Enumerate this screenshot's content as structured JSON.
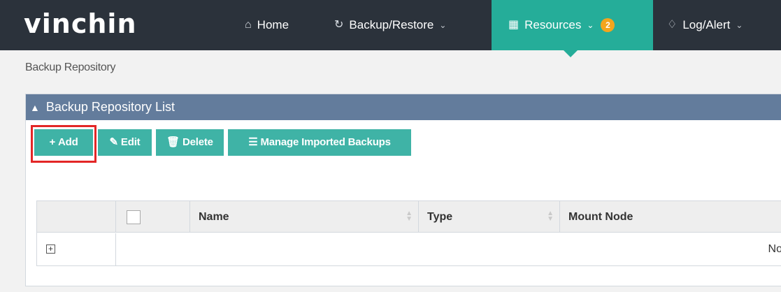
{
  "app": {
    "brand": "vinchin"
  },
  "nav": {
    "home": {
      "label": "Home",
      "icon": "home-icon"
    },
    "backup_restore": {
      "label": "Backup/Restore",
      "icon": "refresh-icon"
    },
    "resources": {
      "label": "Resources",
      "icon": "grid-icon",
      "badge": "2"
    },
    "log_alert": {
      "label": "Log/Alert",
      "icon": "bell-icon"
    }
  },
  "breadcrumb": "Backup Repository",
  "panel": {
    "title": "Backup Repository List"
  },
  "toolbar": {
    "add": "Add",
    "edit": "Edit",
    "delete": "Delete",
    "manage": "Manage Imported Backups"
  },
  "table": {
    "columns": [
      "Name",
      "Type",
      "Mount Node"
    ],
    "empty_text": "No"
  },
  "colors": {
    "topbar": "#2b323b",
    "accent": "#25ad99",
    "button": "#3fb3a6",
    "panel_header": "#637c9c",
    "badge": "#f3a51d",
    "highlight": "#e32626"
  }
}
